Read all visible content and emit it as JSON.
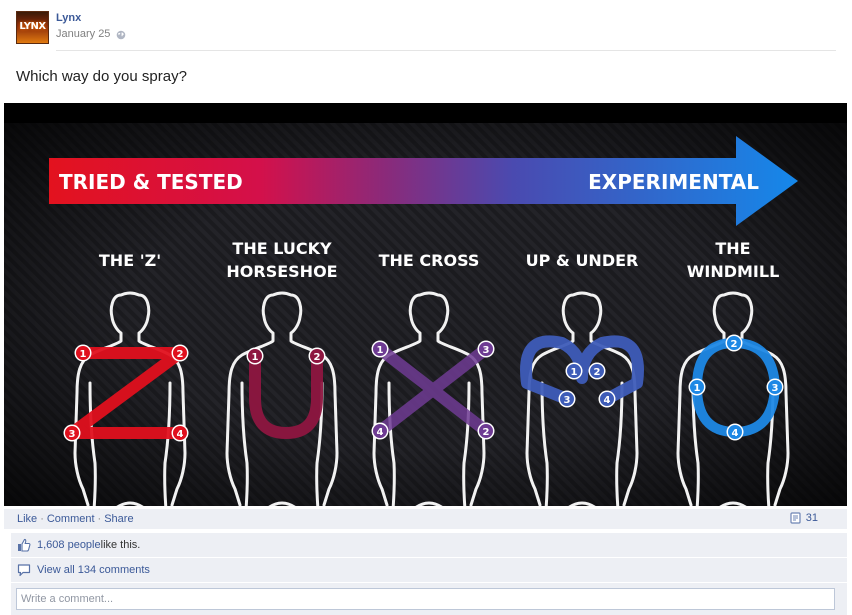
{
  "post": {
    "author": "Lynx",
    "avatar_text": "LYNX",
    "date": "January 25",
    "privacy_icon": "globe-icon",
    "text": "Which way do you spray?"
  },
  "photo": {
    "arrow_left_label": "TRIED & TESTED",
    "arrow_right_label": "EXPERIMENTAL",
    "techniques": [
      {
        "title_lines": [
          "THE 'Z'"
        ],
        "points": [
          "1",
          "2",
          "3",
          "4"
        ],
        "color": "#e0101e"
      },
      {
        "title_lines": [
          "THE LUCKY",
          "HORSESHOE"
        ],
        "points": [
          "1",
          "2"
        ],
        "color": "#8e1640"
      },
      {
        "title_lines": [
          "THE CROSS"
        ],
        "points": [
          "1",
          "3",
          "4",
          "2"
        ],
        "color": "#6e3b93"
      },
      {
        "title_lines": [
          "UP & UNDER"
        ],
        "points": [
          "1",
          "2",
          "3",
          "4"
        ],
        "color": "#3e5cb8"
      },
      {
        "title_lines": [
          "THE",
          "WINDMILL"
        ],
        "points": [
          "2",
          "1",
          "3",
          "4"
        ],
        "color": "#1e88e5"
      }
    ]
  },
  "actions": {
    "like": "Like",
    "comment": "Comment",
    "share": "Share",
    "share_count": "31"
  },
  "likes": {
    "count_text": "1,608 people",
    "suffix": " like this."
  },
  "comments": {
    "view_all": "View all 134 comments"
  },
  "comment_box": {
    "placeholder": "Write a comment..."
  }
}
